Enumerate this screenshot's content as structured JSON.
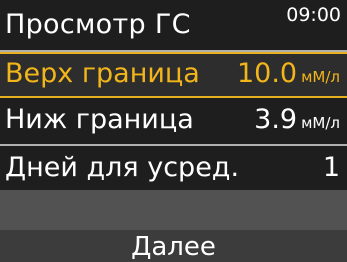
{
  "header": {
    "title": "Просмотр ГС",
    "time": "09:00"
  },
  "rows": [
    {
      "label": "Верх граница",
      "value": "10.0",
      "unit": "мМ/л",
      "selected": true
    },
    {
      "label": "Ниж граница",
      "value": "3.9",
      "unit": "мМ/л",
      "selected": false
    },
    {
      "label": "Дней для усред.",
      "value": "1",
      "selected": false
    }
  ],
  "footer": {
    "button_label": "Далее"
  },
  "colors": {
    "background": "#1e1e1e",
    "highlight": "#f2b51a",
    "selection_border": "#e6b221",
    "empty_band": "#525252",
    "footer": "#3c3c3c"
  }
}
